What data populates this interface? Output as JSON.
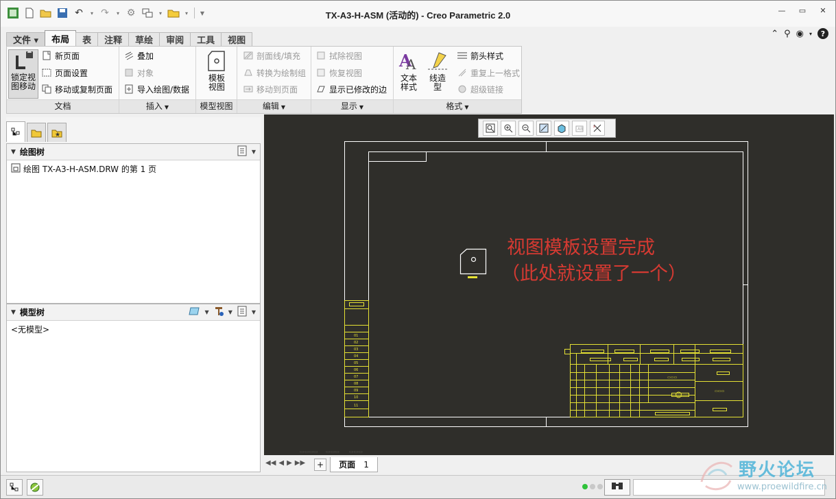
{
  "window": {
    "title": "TX-A3-H-ASM (活动的) - Creo Parametric 2.0"
  },
  "quick_access": {
    "icons": [
      "app-icon",
      "new-icon",
      "open-icon",
      "save-icon",
      "undo-icon",
      "redo-icon",
      "regenerate-icon",
      "windows-icon",
      "folder-icon",
      "customize-icon"
    ]
  },
  "ribbon": {
    "tabs": [
      {
        "label": "文件 ▾",
        "type": "file"
      },
      {
        "label": "布局",
        "active": true
      },
      {
        "label": "表"
      },
      {
        "label": "注释"
      },
      {
        "label": "草绘"
      },
      {
        "label": "审阅"
      },
      {
        "label": "工具"
      },
      {
        "label": "视图"
      }
    ],
    "groups": {
      "document": {
        "label": "文档",
        "lock_view": "锁定视\n图移动",
        "new_page": "新页面",
        "page_setup": "页面设置",
        "move_copy_pages": "移动或复制页面"
      },
      "insert": {
        "label": "插入",
        "overlay": "叠加",
        "object": "对象",
        "import_drawing": "导入绘图/数据"
      },
      "model_views": {
        "label": "模型视图",
        "template_view": "模板\n视图"
      },
      "edit": {
        "label": "编辑",
        "section_hatch": "剖面线/填充",
        "convert_draft_group": "转换为绘制组",
        "move_to_page": "移动到页面"
      },
      "display": {
        "label": "显示",
        "erase_view": "拭除视图",
        "resume_view": "恢复视图",
        "show_modified_edges": "显示已修改的边"
      },
      "format": {
        "label": "格式",
        "text_style": "文本\n样式",
        "line_style": "线造\n型",
        "arrow_style": "箭头样式",
        "repeat_format": "重复上一格式",
        "hyperlink": "超级链接"
      }
    }
  },
  "drawing_tree": {
    "title": "绘图树",
    "item": "绘图 TX-A3-H-ASM.DRW 的第 1 页"
  },
  "model_tree": {
    "title": "模型树",
    "empty": "<无模型>"
  },
  "canvas": {
    "annotation_line1": "视图模板设置完成",
    "annotation_line2": "（此处就设置了一个）",
    "background": "#2f2e2a",
    "frame_color": "#ffffff",
    "titleblock_color": "#e6e234"
  },
  "page_bar": {
    "add": "+",
    "page_label": "页面",
    "page_number": "1"
  },
  "watermark": {
    "name": "野火论坛",
    "url": "www.proewildfire.cn"
  }
}
